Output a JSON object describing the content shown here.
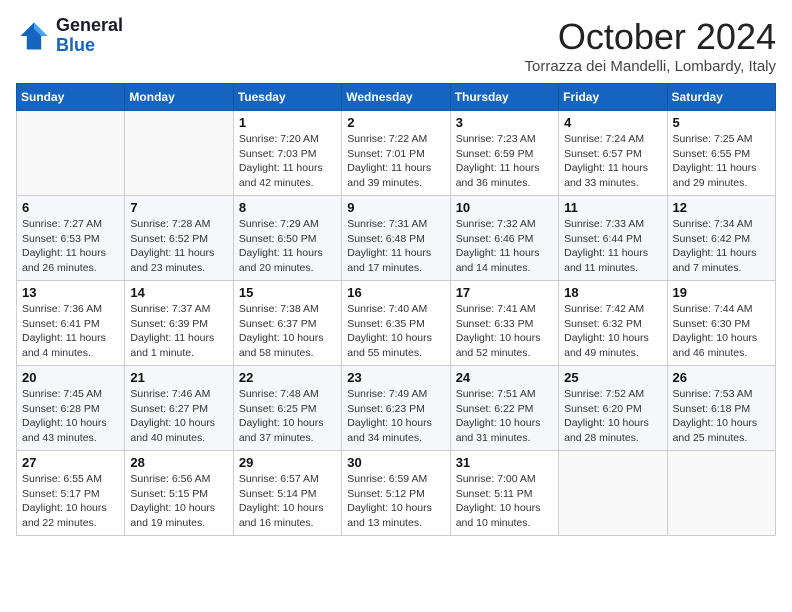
{
  "header": {
    "logo_general": "General",
    "logo_blue": "Blue",
    "month_title": "October 2024",
    "location": "Torrazza dei Mandelli, Lombardy, Italy"
  },
  "weekdays": [
    "Sunday",
    "Monday",
    "Tuesday",
    "Wednesday",
    "Thursday",
    "Friday",
    "Saturday"
  ],
  "weeks": [
    [
      {
        "day": "",
        "sunrise": "",
        "sunset": "",
        "daylight": ""
      },
      {
        "day": "",
        "sunrise": "",
        "sunset": "",
        "daylight": ""
      },
      {
        "day": "1",
        "sunrise": "Sunrise: 7:20 AM",
        "sunset": "Sunset: 7:03 PM",
        "daylight": "Daylight: 11 hours and 42 minutes."
      },
      {
        "day": "2",
        "sunrise": "Sunrise: 7:22 AM",
        "sunset": "Sunset: 7:01 PM",
        "daylight": "Daylight: 11 hours and 39 minutes."
      },
      {
        "day": "3",
        "sunrise": "Sunrise: 7:23 AM",
        "sunset": "Sunset: 6:59 PM",
        "daylight": "Daylight: 11 hours and 36 minutes."
      },
      {
        "day": "4",
        "sunrise": "Sunrise: 7:24 AM",
        "sunset": "Sunset: 6:57 PM",
        "daylight": "Daylight: 11 hours and 33 minutes."
      },
      {
        "day": "5",
        "sunrise": "Sunrise: 7:25 AM",
        "sunset": "Sunset: 6:55 PM",
        "daylight": "Daylight: 11 hours and 29 minutes."
      }
    ],
    [
      {
        "day": "6",
        "sunrise": "Sunrise: 7:27 AM",
        "sunset": "Sunset: 6:53 PM",
        "daylight": "Daylight: 11 hours and 26 minutes."
      },
      {
        "day": "7",
        "sunrise": "Sunrise: 7:28 AM",
        "sunset": "Sunset: 6:52 PM",
        "daylight": "Daylight: 11 hours and 23 minutes."
      },
      {
        "day": "8",
        "sunrise": "Sunrise: 7:29 AM",
        "sunset": "Sunset: 6:50 PM",
        "daylight": "Daylight: 11 hours and 20 minutes."
      },
      {
        "day": "9",
        "sunrise": "Sunrise: 7:31 AM",
        "sunset": "Sunset: 6:48 PM",
        "daylight": "Daylight: 11 hours and 17 minutes."
      },
      {
        "day": "10",
        "sunrise": "Sunrise: 7:32 AM",
        "sunset": "Sunset: 6:46 PM",
        "daylight": "Daylight: 11 hours and 14 minutes."
      },
      {
        "day": "11",
        "sunrise": "Sunrise: 7:33 AM",
        "sunset": "Sunset: 6:44 PM",
        "daylight": "Daylight: 11 hours and 11 minutes."
      },
      {
        "day": "12",
        "sunrise": "Sunrise: 7:34 AM",
        "sunset": "Sunset: 6:42 PM",
        "daylight": "Daylight: 11 hours and 7 minutes."
      }
    ],
    [
      {
        "day": "13",
        "sunrise": "Sunrise: 7:36 AM",
        "sunset": "Sunset: 6:41 PM",
        "daylight": "Daylight: 11 hours and 4 minutes."
      },
      {
        "day": "14",
        "sunrise": "Sunrise: 7:37 AM",
        "sunset": "Sunset: 6:39 PM",
        "daylight": "Daylight: 11 hours and 1 minute."
      },
      {
        "day": "15",
        "sunrise": "Sunrise: 7:38 AM",
        "sunset": "Sunset: 6:37 PM",
        "daylight": "Daylight: 10 hours and 58 minutes."
      },
      {
        "day": "16",
        "sunrise": "Sunrise: 7:40 AM",
        "sunset": "Sunset: 6:35 PM",
        "daylight": "Daylight: 10 hours and 55 minutes."
      },
      {
        "day": "17",
        "sunrise": "Sunrise: 7:41 AM",
        "sunset": "Sunset: 6:33 PM",
        "daylight": "Daylight: 10 hours and 52 minutes."
      },
      {
        "day": "18",
        "sunrise": "Sunrise: 7:42 AM",
        "sunset": "Sunset: 6:32 PM",
        "daylight": "Daylight: 10 hours and 49 minutes."
      },
      {
        "day": "19",
        "sunrise": "Sunrise: 7:44 AM",
        "sunset": "Sunset: 6:30 PM",
        "daylight": "Daylight: 10 hours and 46 minutes."
      }
    ],
    [
      {
        "day": "20",
        "sunrise": "Sunrise: 7:45 AM",
        "sunset": "Sunset: 6:28 PM",
        "daylight": "Daylight: 10 hours and 43 minutes."
      },
      {
        "day": "21",
        "sunrise": "Sunrise: 7:46 AM",
        "sunset": "Sunset: 6:27 PM",
        "daylight": "Daylight: 10 hours and 40 minutes."
      },
      {
        "day": "22",
        "sunrise": "Sunrise: 7:48 AM",
        "sunset": "Sunset: 6:25 PM",
        "daylight": "Daylight: 10 hours and 37 minutes."
      },
      {
        "day": "23",
        "sunrise": "Sunrise: 7:49 AM",
        "sunset": "Sunset: 6:23 PM",
        "daylight": "Daylight: 10 hours and 34 minutes."
      },
      {
        "day": "24",
        "sunrise": "Sunrise: 7:51 AM",
        "sunset": "Sunset: 6:22 PM",
        "daylight": "Daylight: 10 hours and 31 minutes."
      },
      {
        "day": "25",
        "sunrise": "Sunrise: 7:52 AM",
        "sunset": "Sunset: 6:20 PM",
        "daylight": "Daylight: 10 hours and 28 minutes."
      },
      {
        "day": "26",
        "sunrise": "Sunrise: 7:53 AM",
        "sunset": "Sunset: 6:18 PM",
        "daylight": "Daylight: 10 hours and 25 minutes."
      }
    ],
    [
      {
        "day": "27",
        "sunrise": "Sunrise: 6:55 AM",
        "sunset": "Sunset: 5:17 PM",
        "daylight": "Daylight: 10 hours and 22 minutes."
      },
      {
        "day": "28",
        "sunrise": "Sunrise: 6:56 AM",
        "sunset": "Sunset: 5:15 PM",
        "daylight": "Daylight: 10 hours and 19 minutes."
      },
      {
        "day": "29",
        "sunrise": "Sunrise: 6:57 AM",
        "sunset": "Sunset: 5:14 PM",
        "daylight": "Daylight: 10 hours and 16 minutes."
      },
      {
        "day": "30",
        "sunrise": "Sunrise: 6:59 AM",
        "sunset": "Sunset: 5:12 PM",
        "daylight": "Daylight: 10 hours and 13 minutes."
      },
      {
        "day": "31",
        "sunrise": "Sunrise: 7:00 AM",
        "sunset": "Sunset: 5:11 PM",
        "daylight": "Daylight: 10 hours and 10 minutes."
      },
      {
        "day": "",
        "sunrise": "",
        "sunset": "",
        "daylight": ""
      },
      {
        "day": "",
        "sunrise": "",
        "sunset": "",
        "daylight": ""
      }
    ]
  ]
}
